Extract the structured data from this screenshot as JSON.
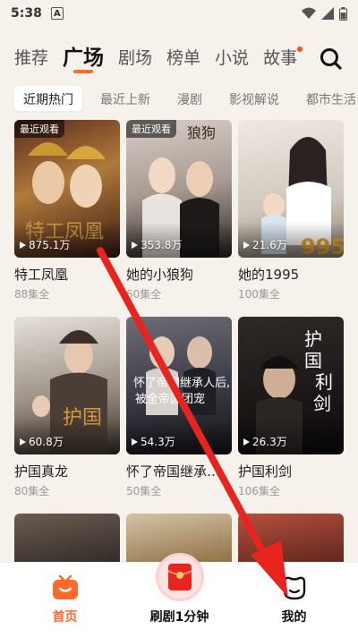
{
  "status": {
    "time": "5:38",
    "notification_letter": "A"
  },
  "topnav": {
    "tabs": [
      {
        "label": "推荐"
      },
      {
        "label": "广场"
      },
      {
        "label": "剧场"
      },
      {
        "label": "榜单"
      },
      {
        "label": "小说"
      },
      {
        "label": "故事"
      }
    ],
    "active_index": 1
  },
  "chips": [
    "近期热门",
    "最近上新",
    "漫剧",
    "影视解说",
    "都市生活"
  ],
  "cards": [
    {
      "title": "特工凤凰",
      "eps": "88集全",
      "plays": "875.1万",
      "badge": "最近观看"
    },
    {
      "title": "她的小狼狗",
      "eps": "60集全",
      "plays": "353.8万",
      "badge": "最近观看"
    },
    {
      "title": "她的1995",
      "eps": "100集全",
      "plays": "21.6万",
      "badge": ""
    },
    {
      "title": "护国真龙",
      "eps": "80集全",
      "plays": "60.8万",
      "badge": ""
    },
    {
      "title": "怀了帝国继承人...",
      "eps": "50集全",
      "plays": "54.3万",
      "badge": ""
    },
    {
      "title": "护国利剑",
      "eps": "106集全",
      "plays": "26.3万",
      "badge": ""
    }
  ],
  "bottom_nav": {
    "home": "首页",
    "center": "刷剧1分钟",
    "me": "我的"
  },
  "colors": {
    "accent": "#ff6a2b",
    "arrow": "#e8241f"
  }
}
